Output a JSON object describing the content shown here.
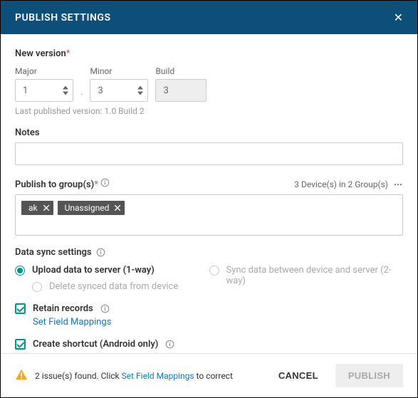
{
  "header": {
    "title": "PUBLISH SETTINGS"
  },
  "version": {
    "label": "New version",
    "major_label": "Major",
    "major_value": "1",
    "minor_label": "Minor",
    "minor_value": "3",
    "build_label": "Build",
    "build_value": "3",
    "hint": "Last published version: 1.0 Build 2"
  },
  "notes": {
    "label": "Notes",
    "value": ""
  },
  "groups": {
    "label": "Publish to group(s)",
    "summary": "3 Device(s) in 2 Group(s)",
    "chips": [
      "ak",
      "Unassigned"
    ]
  },
  "sync": {
    "label": "Data sync settings",
    "upload_label": "Upload data to server (1-way)",
    "delete_label": "Delete synced data from device",
    "twoway_label": "Sync data between device and server (2-way)",
    "retain_label": "Retain records",
    "mappings_link": "Set Field Mappings",
    "shortcut_label": "Create shortcut (Android only)"
  },
  "footer": {
    "warn_pre": "2 issue(s) found. Click ",
    "warn_link": "Set Field Mappings",
    "warn_post": " to correct",
    "cancel": "CANCEL",
    "publish": "PUBLISH"
  }
}
